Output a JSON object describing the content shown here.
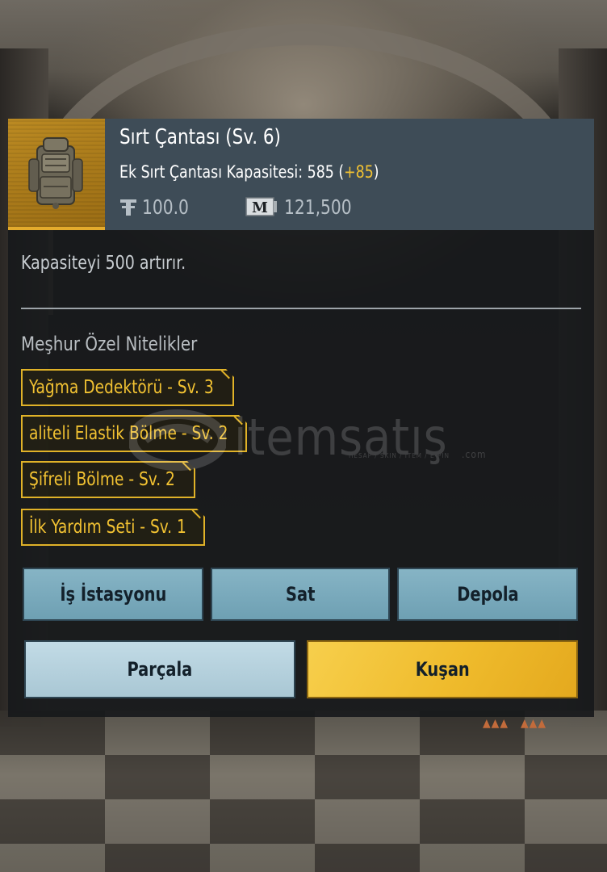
{
  "item": {
    "name": "Sırt Çantası (Sv. 6)",
    "capacity_label": "Ek Sırt Çantası Kapasitesi: 585 (",
    "capacity_bonus": "+85",
    "capacity_close": ")",
    "weight": "100.0",
    "price": "121,500",
    "icon": "backpack-icon"
  },
  "description": "Kapasiteyi 500 artırır.",
  "traits": {
    "title": "Meşhur Özel Nitelikler",
    "items": [
      "Yağma Dedektörü - Sv. 3",
      "aliteli Elastik Bölme - Sv. 2",
      "Şifreli Bölme - Sv. 2",
      "İlk Yardım Seti - Sv. 1"
    ]
  },
  "buttons": {
    "workstation": "İş İstasyonu",
    "sell": "Sat",
    "store": "Depola",
    "dismantle": "Parçala",
    "equip": "Kuşan"
  },
  "watermark": {
    "brand": "itemsatış",
    "tagline": "HESAP / SKIN / ITEM / E-PIN",
    "domain": ".com"
  },
  "colors": {
    "accent_gold": "#f2c232",
    "header_bg": "#3e4c57",
    "button_blue": "#7aaabd"
  }
}
